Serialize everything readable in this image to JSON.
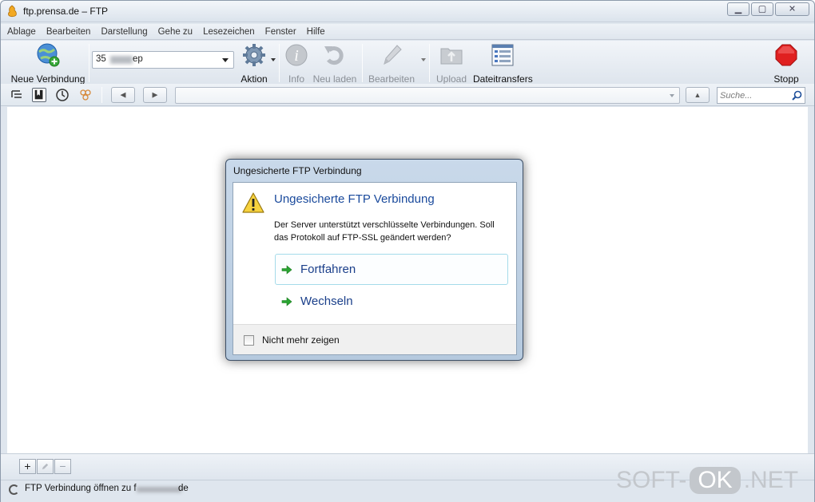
{
  "window": {
    "title": "ftp.prensa.de – FTP",
    "controls": [
      "minimize-icon",
      "maximize-icon",
      "close-icon"
    ]
  },
  "menu": [
    "Ablage",
    "Bearbeiten",
    "Darstellung",
    "Gehe zu",
    "Lesezeichen",
    "Fenster",
    "Hilfe"
  ],
  "toolbar": {
    "new_connection": "Neue Verbindung",
    "connection_value": "35",
    "connection_value_suffix": "ep",
    "action": "Aktion",
    "info": "Info",
    "reload": "Neu laden",
    "edit": "Bearbeiten",
    "upload": "Upload",
    "transfers": "Dateitransfers",
    "stop": "Stopp"
  },
  "navrow": {
    "search_placeholder": "Suche..."
  },
  "bottom": {
    "add": "+",
    "remove": "−"
  },
  "status": {
    "text": "FTP Verbindung öffnen zu f",
    "suffix": "de"
  },
  "watermark": {
    "left": "SOFT-",
    "ok": "OK",
    "right": ".NET"
  },
  "dialog": {
    "title": "Ungesicherte FTP Verbindung",
    "heading": "Ungesicherte FTP Verbindung",
    "message": "Der Server unterstützt verschlüsselte Verbindungen. Soll das Protokoll auf  FTP-SSL geändert werden?",
    "continue": "Fortfahren",
    "switch": "Wechseln",
    "dont_show_again": "Nicht mehr zeigen",
    "dont_show_again_checked": false
  },
  "colors": {
    "accent_heading": "#1a4a9c",
    "command_link": "#1a3f8a",
    "arrow_green": "#2aa532",
    "stop_red": "#e02020"
  }
}
